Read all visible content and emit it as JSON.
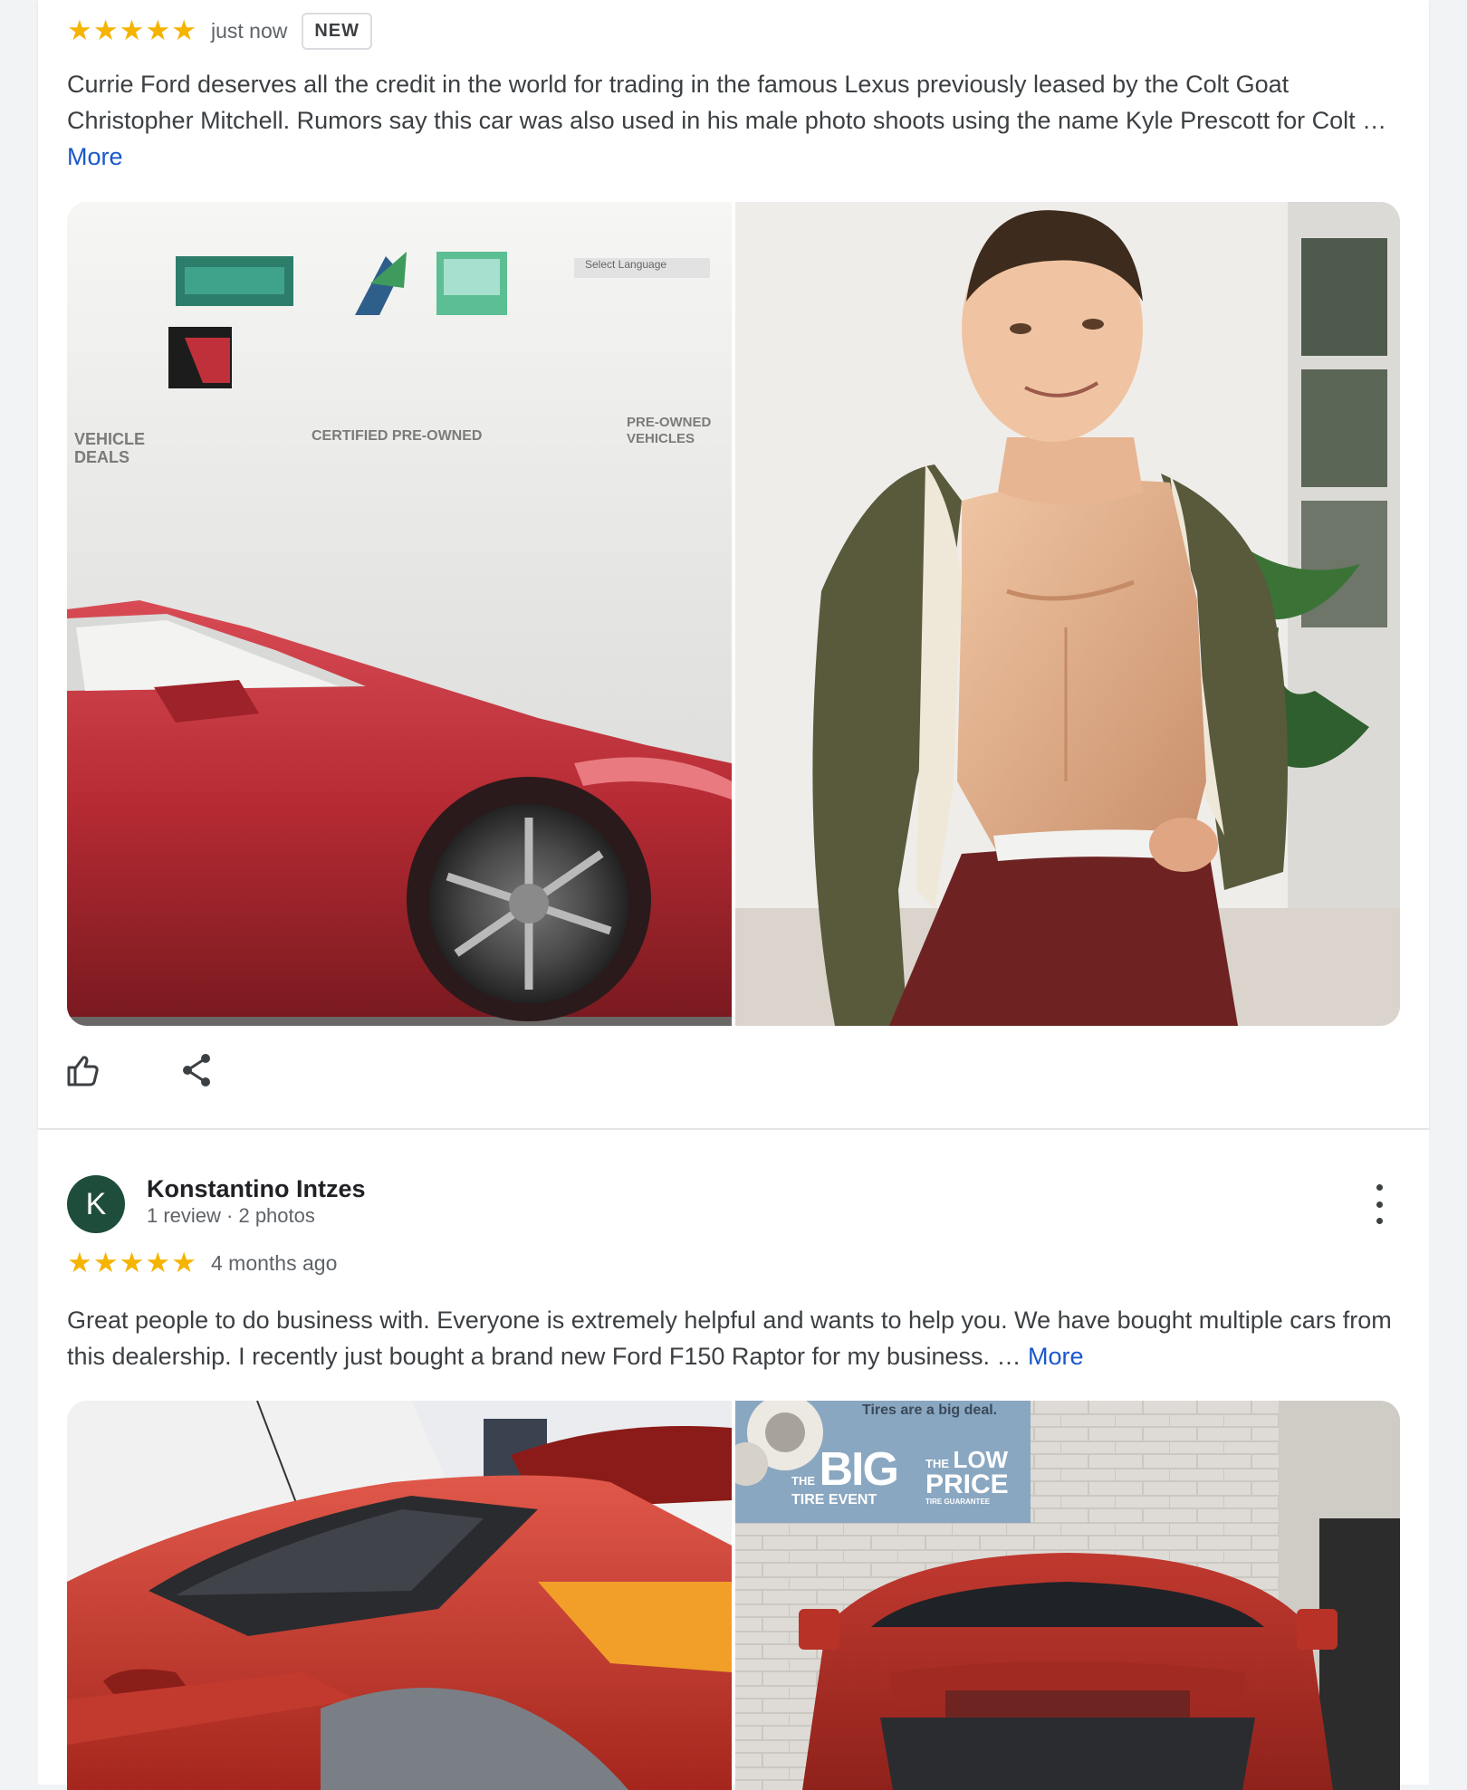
{
  "review1": {
    "stars": [
      "★",
      "★",
      "★",
      "★",
      "★"
    ],
    "time": "just now",
    "badge": "NEW",
    "text": "Currie Ford deserves all the credit in the world for trading in the famous Lexus previously leased by the Colt Goat Christopher Mitchell. Rumors say this car was also used in his male photo shoots using the name Kyle Prescott for Colt … ",
    "more": "More",
    "photo_left_signs": [
      "VEHICLE",
      "DEALS",
      "CERTIFIED PRE-OWNED",
      "PRE-OWNED VEHICLES",
      "Select Language"
    ],
    "actions": {
      "like_icon": "thumbs-up-icon",
      "share_icon": "share-icon"
    }
  },
  "review2": {
    "avatar_letter": "K",
    "author": "Konstantino Intzes",
    "author_stats": "1 review · 2 photos",
    "stars": [
      "★",
      "★",
      "★",
      "★",
      "★"
    ],
    "time": "4 months ago",
    "text": "Great people to do business with. Everyone is extremely helpful and wants to help you. We have bought multiple cars from this dealership. I recently just bought a brand new Ford F150 Raptor for my business. … ",
    "more": "More",
    "menu_icon": "more-vert-icon",
    "banner": {
      "tagline": "Tires are a big deal.",
      "left_the": "THE",
      "left_big": "BIG",
      "left_event": "TIRE EVENT",
      "right_the": "THE",
      "right_low": "LOW",
      "right_price": "PRICE",
      "right_guarantee": "TIRE GUARANTEE"
    }
  },
  "colors": {
    "star": "#f4b400",
    "link": "#1a57c9",
    "avatar_bg": "#1e4d3b"
  }
}
